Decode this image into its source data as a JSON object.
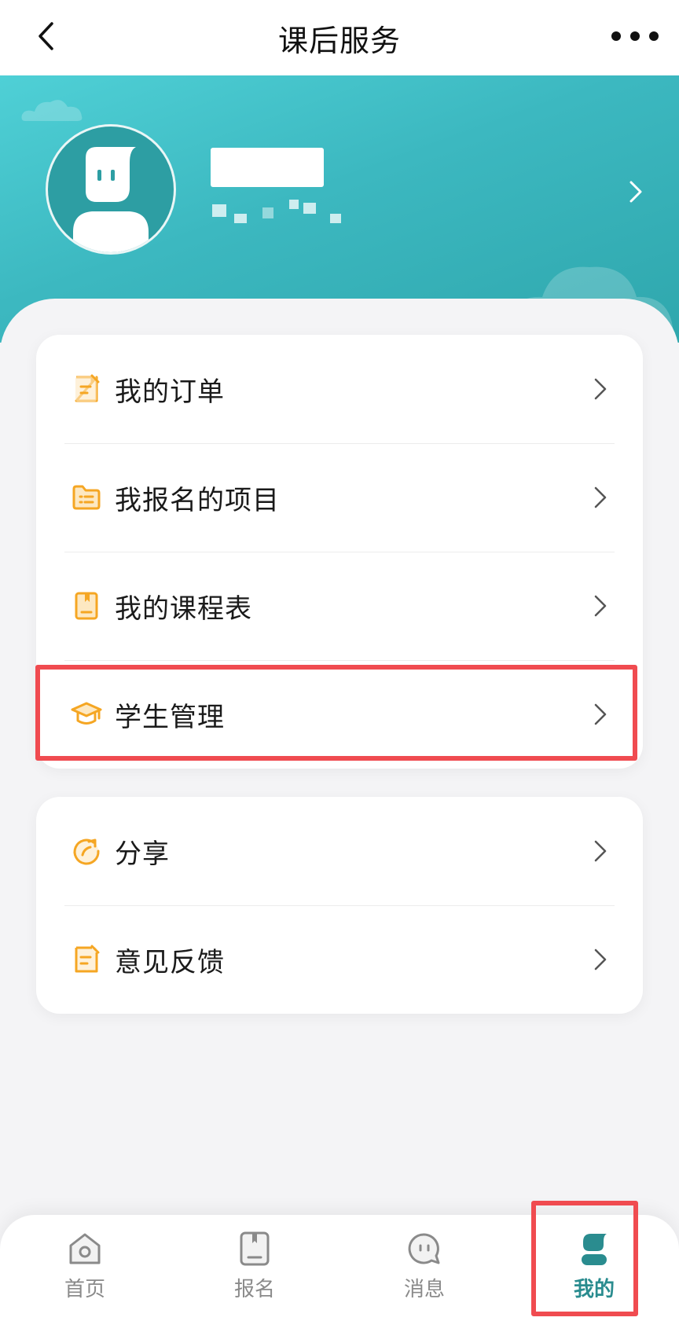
{
  "nav": {
    "title": "课后服务"
  },
  "menu_group_1": [
    {
      "label": "我的订单",
      "icon": "order-icon"
    },
    {
      "label": "我报名的项目",
      "icon": "folder-list-icon"
    },
    {
      "label": "我的课程表",
      "icon": "schedule-icon"
    },
    {
      "label": "学生管理",
      "icon": "graduation-cap-icon"
    }
  ],
  "menu_group_2": [
    {
      "label": "分享",
      "icon": "share-icon"
    },
    {
      "label": "意见反馈",
      "icon": "feedback-icon"
    }
  ],
  "tabbar": [
    {
      "label": "首页",
      "icon": "home-icon",
      "active": false
    },
    {
      "label": "报名",
      "icon": "signup-icon",
      "active": false
    },
    {
      "label": "消息",
      "icon": "message-icon",
      "active": false
    },
    {
      "label": "我的",
      "icon": "profile-icon",
      "active": true
    }
  ],
  "colors": {
    "accent": "#f5a623",
    "banner": "#3cb8c0",
    "active_tab": "#2a8c8f",
    "highlight": "#f04b50"
  }
}
